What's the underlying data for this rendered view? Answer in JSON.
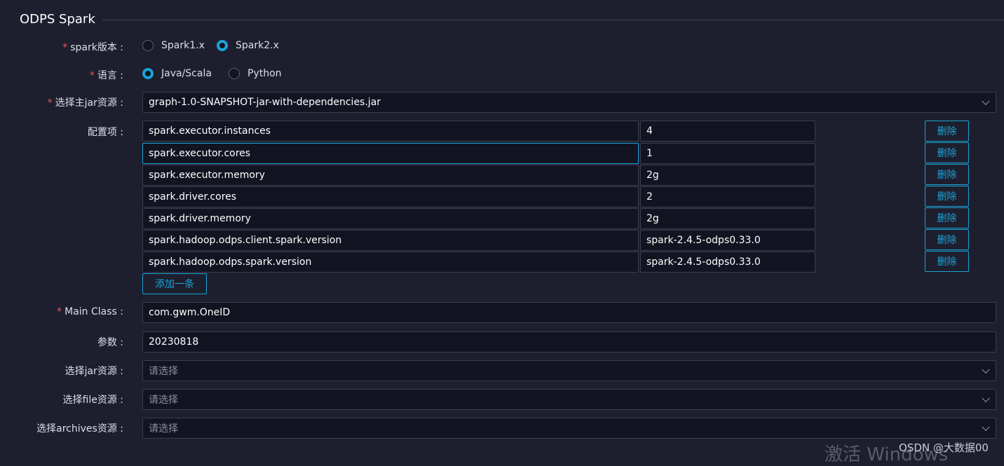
{
  "section": {
    "title": "ODPS Spark"
  },
  "spark_version": {
    "label": "spark版本 :",
    "options": [
      "Spark1.x",
      "Spark2.x"
    ],
    "selected": "Spark2.x"
  },
  "language": {
    "label": "语言 :",
    "options": [
      "Java/Scala",
      "Python"
    ],
    "selected": "Java/Scala"
  },
  "main_jar": {
    "label": "选择主jar资源 :",
    "value": "graph-1.0-SNAPSHOT-jar-with-dependencies.jar"
  },
  "config": {
    "label": "配置项 :",
    "delete_label": "删除",
    "add_label": "添加一条",
    "rows": [
      {
        "key": "spark.executor.instances",
        "value": "4"
      },
      {
        "key": "spark.executor.cores",
        "value": "1"
      },
      {
        "key": "spark.executor.memory",
        "value": "2g"
      },
      {
        "key": "spark.driver.cores",
        "value": "2"
      },
      {
        "key": "spark.driver.memory",
        "value": "2g"
      },
      {
        "key": "spark.hadoop.odps.client.spark.version",
        "value": "spark-2.4.5-odps0.33.0"
      },
      {
        "key": "spark.hadoop.odps.spark.version",
        "value": "spark-2.4.5-odps0.33.0"
      }
    ]
  },
  "main_class": {
    "label": "Main Class :",
    "value": "com.gwm.OneID"
  },
  "params": {
    "label": "参数 :",
    "value": "20230818"
  },
  "jar_resource": {
    "label": "选择jar资源 :",
    "placeholder": "请选择"
  },
  "file_resource": {
    "label": "选择file资源 :",
    "placeholder": "请选择"
  },
  "archives_resource": {
    "label": "选择archives资源 :",
    "placeholder": "请选择"
  },
  "watermark": {
    "os_text": "激活 Windows",
    "credit": "OSDN @大数据00"
  },
  "colors": {
    "accent": "#1aa3d8",
    "required": "#f0505a",
    "background": "#1d1f2e",
    "input_bg": "#121421"
  }
}
